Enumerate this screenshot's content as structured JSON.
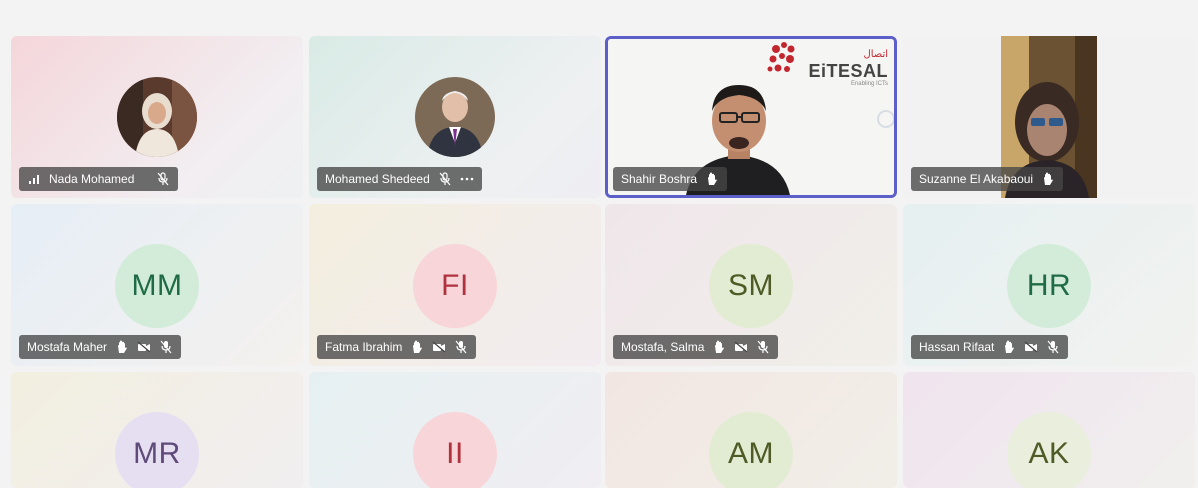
{
  "participants": [
    {
      "name": "Nada Mohamed",
      "type": "photo",
      "bg": [
        "#f4dadd",
        "#f1eef2"
      ],
      "icons": [
        "signal-bars",
        "mic-off"
      ]
    },
    {
      "name": "Mohamed Shedeed",
      "type": "photo",
      "bg": [
        "#dcece8",
        "#eceff2"
      ],
      "icons": [
        "mic-off",
        "more-options"
      ]
    },
    {
      "name": "Shahir Boshra",
      "type": "video",
      "active": true,
      "icons": [
        "hand-raised"
      ]
    },
    {
      "name": "Suzanne El Akabaoui",
      "type": "video",
      "icons": [
        "hand-raised"
      ]
    },
    {
      "name": "Mostafa Maher",
      "initials": "MM",
      "type": "initials",
      "initials_color": "#1f6b45",
      "circle": "#d3ecd9",
      "bg": [
        "#e6eef6",
        "#f4f1ee"
      ],
      "icons": [
        "hand-raised",
        "camera-off",
        "mic"
      ]
    },
    {
      "name": "Fatma Ibrahim",
      "initials": "FI",
      "type": "initials",
      "initials_color": "#b1323f",
      "circle": "#f7d5d8",
      "bg": [
        "#f3eede",
        "#f2ecf0"
      ],
      "icons": [
        "hand-raised",
        "camera-off",
        "mic"
      ]
    },
    {
      "name": "Mostafa, Salma",
      "initials": "SM",
      "type": "initials",
      "initials_color": "#4e5b26",
      "circle": "#e2ecd2",
      "bg": [
        "#efe6ea",
        "#f1efe9"
      ],
      "icons": [
        "hand-raised",
        "camera-off",
        "mic"
      ]
    },
    {
      "name": "Hassan Rifaat",
      "initials": "HR",
      "type": "initials",
      "initials_color": "#1f6b45",
      "circle": "#d3ecd9",
      "bg": [
        "#e5f0f1",
        "#f2f2f0"
      ],
      "icons": [
        "hand-raised",
        "camera-off",
        "mic"
      ]
    },
    {
      "name": "",
      "initials": "MR",
      "type": "initials",
      "initials_color": "#5f4a7a",
      "circle": "#e6dff2",
      "bg": [
        "#f2efe0",
        "#f1eef0"
      ],
      "icons": []
    },
    {
      "name": "",
      "initials": "II",
      "type": "initials",
      "initials_color": "#b1323f",
      "circle": "#f7d5d8",
      "bg": [
        "#e6f0f2",
        "#f0eef2"
      ],
      "icons": []
    },
    {
      "name": "",
      "initials": "AM",
      "type": "initials",
      "initials_color": "#4e5b26",
      "circle": "#e2ecd2",
      "bg": [
        "#f2e6e2",
        "#f1eee8"
      ],
      "icons": []
    },
    {
      "name": "",
      "initials": "AK",
      "type": "initials",
      "initials_color": "#4e5b26",
      "circle": "#e9efdc",
      "bg": [
        "#f0e4ee",
        "#f1efee"
      ],
      "icons": []
    }
  ],
  "logo": {
    "latin": "EiTESAL",
    "arabic": "اتصال",
    "tagline": "Enabling ICTs"
  },
  "colors": {
    "active_border": "#5b5fc7",
    "accent": "#c2262e"
  }
}
